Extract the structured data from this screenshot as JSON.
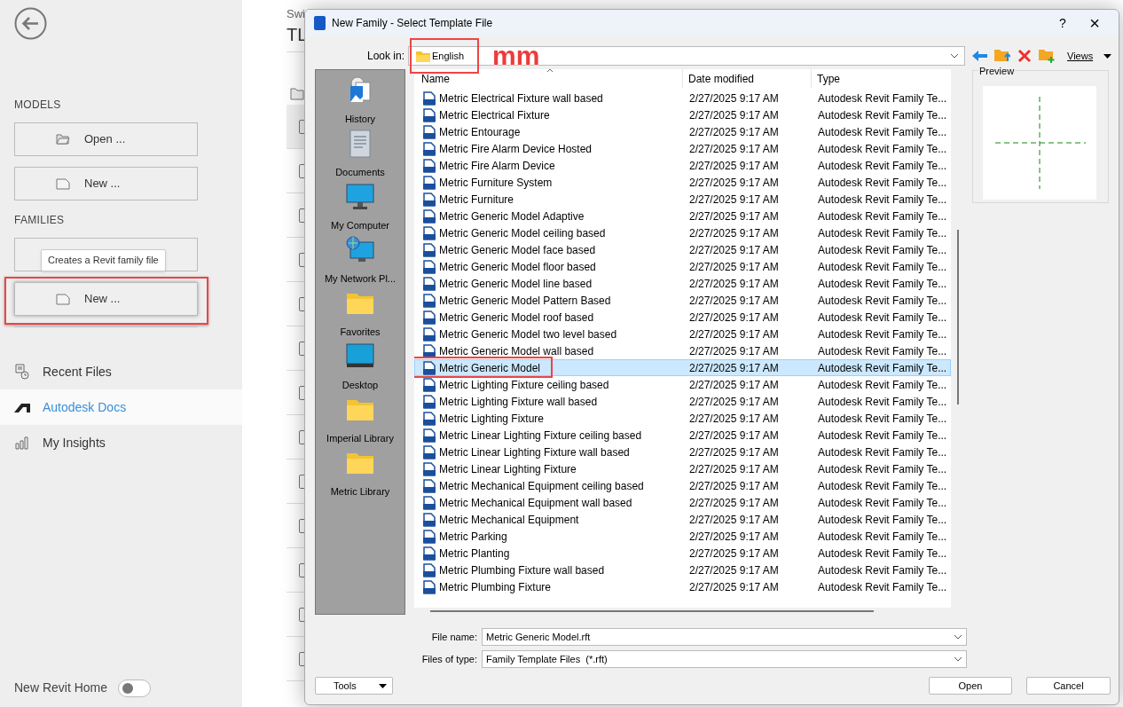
{
  "sidebar": {
    "sections": [
      {
        "title": "MODELS",
        "buttons": [
          {
            "kind": "open",
            "label": "Open ...",
            "highlighted": false
          },
          {
            "kind": "new",
            "label": "New ...",
            "highlighted": false
          }
        ]
      },
      {
        "title": "FAMILIES",
        "buttons": [
          {
            "kind": "open",
            "tooltip": "Creates a Revit family file",
            "highlighted": false
          },
          {
            "kind": "new",
            "label": "New ...",
            "highlighted": true
          }
        ]
      }
    ],
    "nav": [
      {
        "kind": "recent",
        "label": "Recent Files",
        "selected": false
      },
      {
        "kind": "docs",
        "label": "Autodesk Docs",
        "selected": true
      },
      {
        "kind": "insights",
        "label": "My Insights",
        "selected": false
      }
    ],
    "toggle": {
      "label": "New Revit Home",
      "on": false
    }
  },
  "background_page": {
    "subtitle": "Swi",
    "title": "TL",
    "rows": [
      {
        "checked": false
      },
      {
        "checked": false
      },
      {
        "checked": false
      },
      {
        "checked": false
      },
      {
        "checked": false
      },
      {
        "checked": false
      },
      {
        "checked": false
      },
      {
        "checked": false
      },
      {
        "checked": false
      },
      {
        "checked": false
      },
      {
        "checked": false
      },
      {
        "checked": false
      },
      {
        "checked": false
      }
    ]
  },
  "dialog": {
    "title": "New Family - Select Template File",
    "help": "?",
    "close": "×",
    "look_in": {
      "label": "Look in:",
      "value": "English",
      "highlighted": true
    },
    "annotation": "mm",
    "views": "Views",
    "places": [
      {
        "kind": "history",
        "label": "History"
      },
      {
        "kind": "documents",
        "label": "Documents"
      },
      {
        "kind": "computer",
        "label": "My Computer"
      },
      {
        "kind": "network",
        "label": "My Network Pl..."
      },
      {
        "kind": "folder",
        "label": "Favorites"
      },
      {
        "kind": "desktop",
        "label": "Desktop"
      },
      {
        "kind": "folder",
        "label": "Imperial Library"
      },
      {
        "kind": "folder",
        "label": "Metric Library"
      }
    ],
    "columns": [
      "Name",
      "Date modified",
      "Type"
    ],
    "rows": [
      {
        "name": "Metric Electrical Fixture wall based",
        "date": "2/27/2025 9:17 AM",
        "type": "Autodesk Revit Family Te...",
        "selected": false,
        "highlighted": false
      },
      {
        "name": "Metric Electrical Fixture",
        "date": "2/27/2025 9:17 AM",
        "type": "Autodesk Revit Family Te...",
        "selected": false,
        "highlighted": false
      },
      {
        "name": "Metric Entourage",
        "date": "2/27/2025 9:17 AM",
        "type": "Autodesk Revit Family Te...",
        "selected": false,
        "highlighted": false
      },
      {
        "name": "Metric Fire Alarm Device Hosted",
        "date": "2/27/2025 9:17 AM",
        "type": "Autodesk Revit Family Te...",
        "selected": false,
        "highlighted": false
      },
      {
        "name": "Metric Fire Alarm Device",
        "date": "2/27/2025 9:17 AM",
        "type": "Autodesk Revit Family Te...",
        "selected": false,
        "highlighted": false
      },
      {
        "name": "Metric Furniture System",
        "date": "2/27/2025 9:17 AM",
        "type": "Autodesk Revit Family Te...",
        "selected": false,
        "highlighted": false
      },
      {
        "name": "Metric Furniture",
        "date": "2/27/2025 9:17 AM",
        "type": "Autodesk Revit Family Te...",
        "selected": false,
        "highlighted": false
      },
      {
        "name": "Metric Generic Model Adaptive",
        "date": "2/27/2025 9:17 AM",
        "type": "Autodesk Revit Family Te...",
        "selected": false,
        "highlighted": false
      },
      {
        "name": "Metric Generic Model ceiling based",
        "date": "2/27/2025 9:17 AM",
        "type": "Autodesk Revit Family Te...",
        "selected": false,
        "highlighted": false
      },
      {
        "name": "Metric Generic Model face based",
        "date": "2/27/2025 9:17 AM",
        "type": "Autodesk Revit Family Te...",
        "selected": false,
        "highlighted": false
      },
      {
        "name": "Metric Generic Model floor based",
        "date": "2/27/2025 9:17 AM",
        "type": "Autodesk Revit Family Te...",
        "selected": false,
        "highlighted": false
      },
      {
        "name": "Metric Generic Model line based",
        "date": "2/27/2025 9:17 AM",
        "type": "Autodesk Revit Family Te...",
        "selected": false,
        "highlighted": false
      },
      {
        "name": "Metric Generic Model Pattern Based",
        "date": "2/27/2025 9:17 AM",
        "type": "Autodesk Revit Family Te...",
        "selected": false,
        "highlighted": false
      },
      {
        "name": "Metric Generic Model roof based",
        "date": "2/27/2025 9:17 AM",
        "type": "Autodesk Revit Family Te...",
        "selected": false,
        "highlighted": false
      },
      {
        "name": "Metric Generic Model two level based",
        "date": "2/27/2025 9:17 AM",
        "type": "Autodesk Revit Family Te...",
        "selected": false,
        "highlighted": false
      },
      {
        "name": "Metric Generic Model wall based",
        "date": "2/27/2025 9:17 AM",
        "type": "Autodesk Revit Family Te...",
        "selected": false,
        "highlighted": false
      },
      {
        "name": "Metric Generic Model",
        "date": "2/27/2025 9:17 AM",
        "type": "Autodesk Revit Family Te...",
        "selected": true,
        "highlighted": true
      },
      {
        "name": "Metric Lighting Fixture ceiling based",
        "date": "2/27/2025 9:17 AM",
        "type": "Autodesk Revit Family Te...",
        "selected": false,
        "highlighted": false
      },
      {
        "name": "Metric Lighting Fixture wall based",
        "date": "2/27/2025 9:17 AM",
        "type": "Autodesk Revit Family Te...",
        "selected": false,
        "highlighted": false
      },
      {
        "name": "Metric Lighting Fixture",
        "date": "2/27/2025 9:17 AM",
        "type": "Autodesk Revit Family Te...",
        "selected": false,
        "highlighted": false
      },
      {
        "name": "Metric Linear Lighting Fixture ceiling based",
        "date": "2/27/2025 9:17 AM",
        "type": "Autodesk Revit Family Te...",
        "selected": false,
        "highlighted": false
      },
      {
        "name": "Metric Linear Lighting Fixture wall based",
        "date": "2/27/2025 9:17 AM",
        "type": "Autodesk Revit Family Te...",
        "selected": false,
        "highlighted": false
      },
      {
        "name": "Metric Linear Lighting Fixture",
        "date": "2/27/2025 9:17 AM",
        "type": "Autodesk Revit Family Te...",
        "selected": false,
        "highlighted": false
      },
      {
        "name": "Metric Mechanical Equipment ceiling based",
        "date": "2/27/2025 9:17 AM",
        "type": "Autodesk Revit Family Te...",
        "selected": false,
        "highlighted": false
      },
      {
        "name": "Metric Mechanical Equipment wall based",
        "date": "2/27/2025 9:17 AM",
        "type": "Autodesk Revit Family Te...",
        "selected": false,
        "highlighted": false
      },
      {
        "name": "Metric Mechanical Equipment",
        "date": "2/27/2025 9:17 AM",
        "type": "Autodesk Revit Family Te...",
        "selected": false,
        "highlighted": false
      },
      {
        "name": "Metric Parking",
        "date": "2/27/2025 9:17 AM",
        "type": "Autodesk Revit Family Te...",
        "selected": false,
        "highlighted": false
      },
      {
        "name": "Metric Planting",
        "date": "2/27/2025 9:17 AM",
        "type": "Autodesk Revit Family Te...",
        "selected": false,
        "highlighted": false
      },
      {
        "name": "Metric Plumbing Fixture wall based",
        "date": "2/27/2025 9:17 AM",
        "type": "Autodesk Revit Family Te...",
        "selected": false,
        "highlighted": false
      },
      {
        "name": "Metric Plumbing Fixture",
        "date": "2/27/2025 9:17 AM",
        "type": "Autodesk Revit Family Te...",
        "selected": false,
        "highlighted": false
      }
    ],
    "preview_label": "Preview",
    "file_name": {
      "label": "File name:",
      "value": "Metric Generic Model.rft"
    },
    "file_type": {
      "label": "Files of type:",
      "value": "Family Template Files  (*.rft)"
    },
    "buttons": {
      "tools": "Tools",
      "open": "Open",
      "cancel": "Cancel"
    }
  }
}
